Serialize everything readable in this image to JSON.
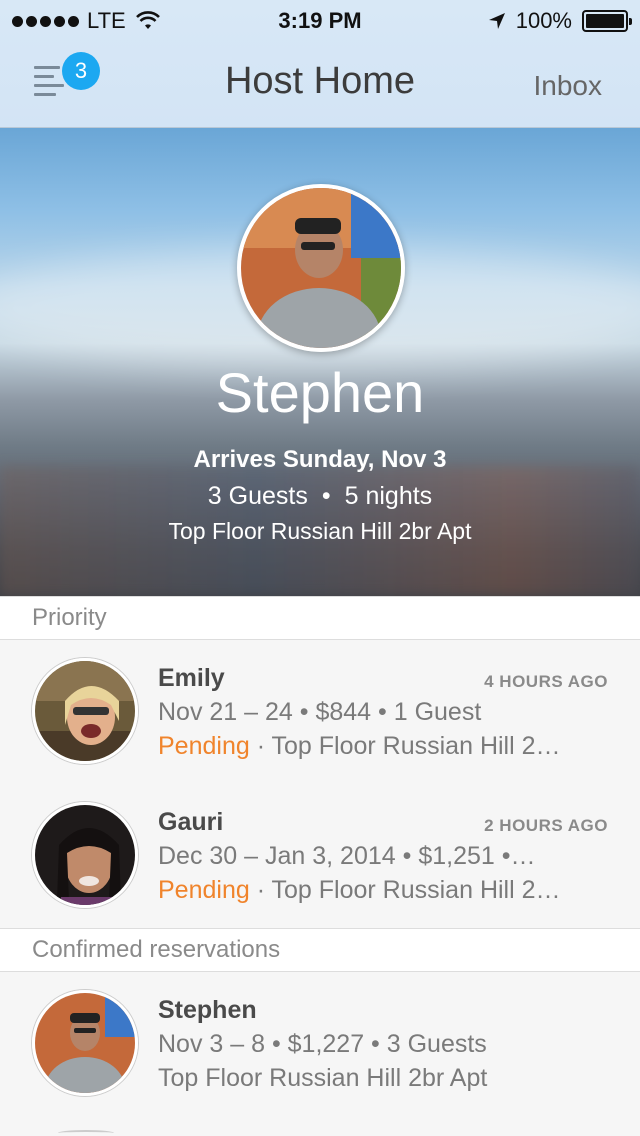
{
  "status_bar": {
    "carrier": "LTE",
    "time": "3:19 PM",
    "battery": "100%",
    "signal_icon": "signal-dots-icon",
    "wifi_icon": "wifi-icon",
    "location_icon": "location-arrow-icon",
    "battery_icon": "battery-icon"
  },
  "nav": {
    "menu_badge": "3",
    "title": "Host Home",
    "inbox_label": "Inbox",
    "menu_icon": "menu-icon",
    "accent_color": "#1ca8f1"
  },
  "hero": {
    "name": "Stephen",
    "arrives": "Arrives Sunday, Nov 3",
    "guests": "3 Guests",
    "separator": "•",
    "nights": "5 nights",
    "listing": "Top Floor Russian Hill 2br Apt"
  },
  "sections": [
    {
      "title": "Priority",
      "items": [
        {
          "name": "Emily",
          "time": "4 HOURS AGO",
          "details": "Nov 21 – 24 • $844 • 1 Guest",
          "status": "Pending",
          "listing": " · Top Floor Russian Hill 2…"
        },
        {
          "name": "Gauri",
          "time": "2 HOURS AGO",
          "details": "Dec 30 – Jan 3, 2014 • $1,251 •…",
          "status": "Pending",
          "listing": " · Top Floor Russian Hill 2…"
        }
      ]
    },
    {
      "title": "Confirmed reservations",
      "items": [
        {
          "name": "Stephen",
          "details": "Nov 3 – 8 • $1,227 • 3 Guests",
          "listing": "Top Floor Russian Hill 2br Apt"
        }
      ]
    }
  ],
  "colors": {
    "pending": "#f0842c",
    "nav_bar": "#d3e4f5"
  }
}
